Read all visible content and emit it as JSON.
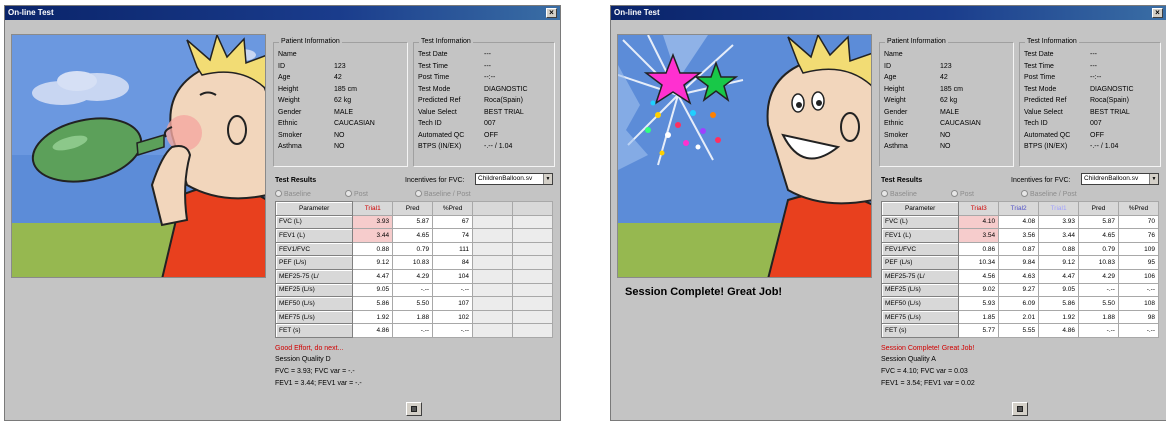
{
  "colors": {
    "title_bar": "#0a246a",
    "highlight": "#f6cccc",
    "message_red": "#d00000"
  },
  "windows": [
    {
      "title": "On-line Test",
      "scene": "boy-inflating-green-balloon",
      "scene_message": "",
      "patient": {
        "group_title": "Patient Information",
        "rows": [
          [
            "Name",
            ""
          ],
          [
            "ID",
            "123"
          ],
          [
            "Age",
            "42"
          ],
          [
            "Height",
            "185 cm"
          ],
          [
            "Weight",
            "62 kg"
          ],
          [
            "Gender",
            "MALE"
          ],
          [
            "Ethnic",
            "CAUCASIAN"
          ],
          [
            "Smoker",
            "NO"
          ],
          [
            "Asthma",
            "NO"
          ]
        ]
      },
      "test": {
        "group_title": "Test Information",
        "rows": [
          [
            "Test Date",
            "---"
          ],
          [
            "Test Time",
            "---"
          ],
          [
            "Post Time",
            "--:--"
          ],
          [
            "Test Mode",
            "DIAGNOSTIC"
          ],
          [
            "Predicted Ref",
            "Roca(Spain)"
          ],
          [
            "Value Select",
            "BEST TRIAL"
          ],
          [
            "Tech ID",
            "007"
          ],
          [
            "Automated QC",
            "OFF"
          ],
          [
            "BTPS (IN/EX)",
            "-.-- / 1.04"
          ]
        ]
      },
      "results_title": "Test Results",
      "incentives_label": "Incentives for FVC:",
      "incentive_value": "ChildrenBalloon.sv",
      "radios": [
        "Baseline",
        "Post",
        "Baseline / Post"
      ],
      "table": {
        "headers": [
          "Parameter",
          "Trial1",
          "Pred",
          "%Pred",
          "",
          ""
        ],
        "header_colors": [
          "#000000",
          "#d00000",
          "#000000",
          "#000000",
          "#000000",
          "#000000"
        ],
        "rows": [
          [
            "FVC (L)",
            "3.93",
            "5.87",
            "67",
            "",
            ""
          ],
          [
            "FEV1 (L)",
            "3.44",
            "4.65",
            "74",
            "",
            ""
          ],
          [
            "FEV1/FVC",
            "0.88",
            "0.79",
            "111",
            "",
            ""
          ],
          [
            "PEF (L/s)",
            "9.12",
            "10.83",
            "84",
            "",
            ""
          ],
          [
            "MEF25-75 (L/",
            "4.47",
            "4.29",
            "104",
            "",
            ""
          ],
          [
            "MEF25 (L/s)",
            "9.05",
            "-.--",
            "-.--",
            "",
            ""
          ],
          [
            "MEF50 (L/s)",
            "5.86",
            "5.50",
            "107",
            "",
            ""
          ],
          [
            "MEF75 (L/s)",
            "1.92",
            "1.88",
            "102",
            "",
            ""
          ],
          [
            "FET (s)",
            "4.86",
            "-.--",
            "-.--",
            "",
            ""
          ]
        ],
        "highlight_cols": [
          1
        ],
        "empty_cols": [
          4,
          5
        ]
      },
      "message": "Good Effort, do next...",
      "session_quality": "Session Quality  D",
      "fvc_line": "FVC = 3.93;  FVC var = -.-",
      "fev1_line": "FEV1 = 3.44;  FEV1 var = -.-"
    },
    {
      "title": "On-line Test",
      "scene": "boy-smiling-balloon-burst-stars",
      "scene_message": "Session Complete! Great Job!",
      "patient": {
        "group_title": "Patient Information",
        "rows": [
          [
            "Name",
            ""
          ],
          [
            "ID",
            "123"
          ],
          [
            "Age",
            "42"
          ],
          [
            "Height",
            "185 cm"
          ],
          [
            "Weight",
            "62 kg"
          ],
          [
            "Gender",
            "MALE"
          ],
          [
            "Ethnic",
            "CAUCASIAN"
          ],
          [
            "Smoker",
            "NO"
          ],
          [
            "Asthma",
            "NO"
          ]
        ]
      },
      "test": {
        "group_title": "Test Information",
        "rows": [
          [
            "Test Date",
            "---"
          ],
          [
            "Test Time",
            "---"
          ],
          [
            "Post Time",
            "--:--"
          ],
          [
            "Test Mode",
            "DIAGNOSTIC"
          ],
          [
            "Predicted Ref",
            "Roca(Spain)"
          ],
          [
            "Value Select",
            "BEST TRIAL"
          ],
          [
            "Tech ID",
            "007"
          ],
          [
            "Automated QC",
            "OFF"
          ],
          [
            "BTPS (IN/EX)",
            "-.-- / 1.04"
          ]
        ]
      },
      "results_title": "Test Results",
      "incentives_label": "Incentives for FVC:",
      "incentive_value": "ChildrenBalloon.sv",
      "radios": [
        "Baseline",
        "Post",
        "Baseline / Post"
      ],
      "table": {
        "headers": [
          "Parameter",
          "Trial3",
          "Trial2",
          "Trial1",
          "Pred",
          "%Pred"
        ],
        "header_colors": [
          "#000000",
          "#d00000",
          "#5050c8",
          "#a0a0ff",
          "#000000",
          "#000000"
        ],
        "rows": [
          [
            "FVC (L)",
            "4.10",
            "4.08",
            "3.93",
            "5.87",
            "70"
          ],
          [
            "FEV1 (L)",
            "3.54",
            "3.56",
            "3.44",
            "4.65",
            "76"
          ],
          [
            "FEV1/FVC",
            "0.86",
            "0.87",
            "0.88",
            "0.79",
            "109"
          ],
          [
            "PEF (L/s)",
            "10.34",
            "9.84",
            "9.12",
            "10.83",
            "95"
          ],
          [
            "MEF25-75 (L/",
            "4.56",
            "4.63",
            "4.47",
            "4.29",
            "106"
          ],
          [
            "MEF25 (L/s)",
            "9.02",
            "9.27",
            "9.05",
            "-.--",
            "-.--"
          ],
          [
            "MEF50 (L/s)",
            "5.93",
            "6.09",
            "5.86",
            "5.50",
            "108"
          ],
          [
            "MEF75 (L/s)",
            "1.85",
            "2.01",
            "1.92",
            "1.88",
            "98"
          ],
          [
            "FET (s)",
            "5.77",
            "5.55",
            "4.86",
            "-.--",
            "-.--"
          ]
        ],
        "highlight_cols": [
          1
        ],
        "empty_cols": []
      },
      "message": "Session Complete! Great Job!",
      "session_quality": "Session Quality  A",
      "fvc_line": "FVC = 4.10;  FVC var = 0.03",
      "fev1_line": "FEV1 = 3.54;  FEV1 var = 0.02"
    }
  ]
}
